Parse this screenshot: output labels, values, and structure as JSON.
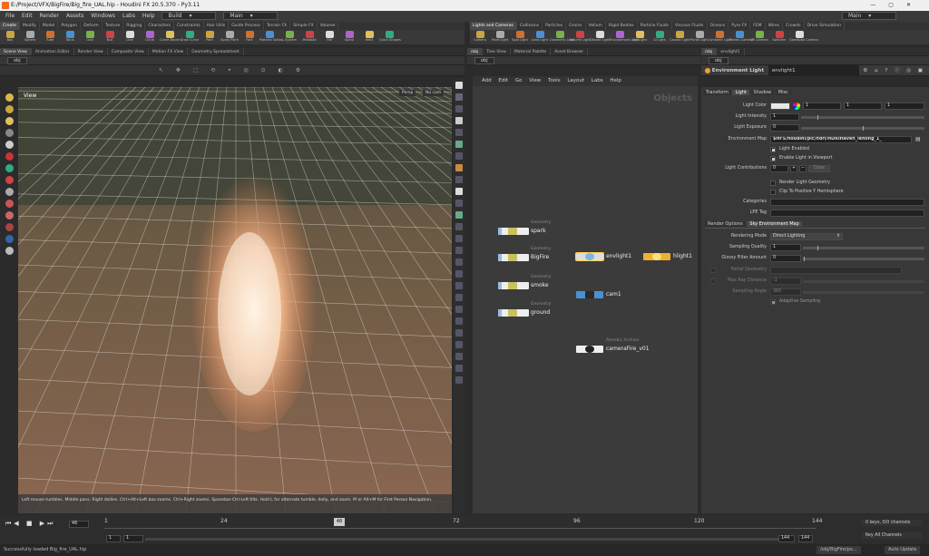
{
  "window": {
    "title": "E:/Project/VFX/BigFire/Big_fire_UAL.hip - Houdini FX 20.5.370 - Py3.11"
  },
  "menu": {
    "items": [
      "File",
      "Edit",
      "Render",
      "Assets",
      "Windows",
      "Labs",
      "Help"
    ],
    "build": "Build",
    "desktop": "Main"
  },
  "shelf_left": {
    "tabs": [
      "Create",
      "Modify",
      "Model",
      "Polygon",
      "Deform",
      "Texture",
      "Rigging",
      "Characters",
      "Constraints",
      "Hair Utils",
      "Guide Process",
      "Terrain FX",
      "Simple FX",
      "Volume"
    ],
    "tools": [
      "Box",
      "Sphere",
      "Tube",
      "Torus",
      "Grid",
      "Null",
      "Line",
      "Circle",
      "Curve Bezier",
      "Draw Curve",
      "Path",
      "Spray Paint",
      "Font",
      "Platonic Solids",
      "L-System",
      "Metaball",
      "File",
      "Spiral",
      "Helix",
      "Quick Shapes"
    ]
  },
  "shelf_right": {
    "tabs": [
      "Lights and Cameras",
      "Collisions",
      "Particles",
      "Grains",
      "Vellum",
      "Rigid Bodies",
      "Particle Fluids",
      "Viscous Fluids",
      "Oceans",
      "Pyro FX",
      "FEM",
      "Wires",
      "Crowds",
      "Drive Simulation"
    ],
    "tools": [
      "Camera",
      "Point Light",
      "Spot Light",
      "Area Light",
      "Geometry Light",
      "Volume Light",
      "Distant Light",
      "Environment Light",
      "Sky Light",
      "GI Light",
      "Caustic Light",
      "Portal Light",
      "Ambient Light",
      "Stereo Camera",
      "VR Camera",
      "Switcher",
      "Gamepad Camera"
    ]
  },
  "left_panes": {
    "tabs": [
      "Scene View",
      "Animation Editor",
      "Render View",
      "Composite View",
      "Motion FX View",
      "Geometry Spreadsheet"
    ],
    "path": "obj"
  },
  "viewport": {
    "label": "View",
    "persp": "Persp",
    "cam": "No cam",
    "hint": "Left mouse tumbles. Middle pans. Right dollies. Ctrl+Alt+Left box-zooms. Ctrl+Right zooms. Spacebar-Ctrl-Left tilts. Hold L for alternate tumble, dolly, and zoom. M or Alt+M for First Person Navigation."
  },
  "network": {
    "tabs": [
      "/obj",
      "Tree View",
      "Material Palette",
      "Asset Browser"
    ],
    "path": "obj",
    "menu": [
      "Add",
      "Edit",
      "Go",
      "View",
      "Tools",
      "Layout",
      "Labs",
      "Help"
    ],
    "context_label": "Objects",
    "nodes": [
      {
        "name": "spark",
        "type": "Geometry"
      },
      {
        "name": "BigFire",
        "type": "Geometry"
      },
      {
        "name": "smoke",
        "type": "Geometry"
      },
      {
        "name": "ground",
        "type": "Geometry"
      },
      {
        "name": "envlight1",
        "type": ""
      },
      {
        "name": "hlight1",
        "type": ""
      },
      {
        "name": "cam1",
        "type": ""
      },
      {
        "name": "cameraFire_v01",
        "type": "Alembic Archive"
      }
    ]
  },
  "params": {
    "tabs": [
      "/obj",
      "envlight1"
    ],
    "path": "obj",
    "node_type": "Environment Light",
    "node_name": "envlight1",
    "subtabs": [
      "Transform",
      "Light",
      "Shadow",
      "Misc"
    ],
    "light_color_label": "Light Color",
    "light_color": [
      "1",
      "1",
      "1"
    ],
    "intensity_label": "Light Intensity",
    "intensity": "1",
    "exposure_label": "Light Exposure",
    "exposure": "0",
    "envmap_label": "Environment Map",
    "envmap": "$HFS/houdini/pic/hdri/HDRIHaven_lenong_1_",
    "light_enabled": "Light Enabled",
    "enable_viewport": "Enable Light in Viewport",
    "contrib_label": "Light Contributions",
    "contrib": "0",
    "clear": "Clear",
    "render_geo": "Render Light Geometry",
    "clip_hemi": "Clip To Positive Y Hemisphere",
    "categories_label": "Categories",
    "lpe_label": "LPE Tag",
    "section_tabs": [
      "Render Options",
      "Sky Environment Map"
    ],
    "rendering_mode_label": "Rendering Mode",
    "rendering_mode": "Direct Lighting",
    "sampling_quality_label": "Sampling Quality",
    "sampling_quality": "1",
    "glossy_label": "Glossy Filter Amount",
    "glossy": "0",
    "portal_label": "Portal Geometry",
    "max_ray_label": "Max Ray Distance",
    "max_ray": "-1",
    "sampling_angle_label": "Sampling Angle",
    "sampling_angle": "360",
    "adaptive": "Adaptive Sampling"
  },
  "timeline": {
    "frame": "48",
    "start": "1",
    "end": "144",
    "start2": "1",
    "end2": "144",
    "ticks": [
      "1",
      "24",
      "48",
      "72",
      "96",
      "120",
      "144"
    ],
    "keys": "0 keys, 0/0 channels",
    "key_all": "Key All Channels"
  },
  "status": {
    "message": "Successfully loaded Big_fire_UAL.hip",
    "path": "/obj/BigFire/po...",
    "auto_update": "Auto Update"
  }
}
